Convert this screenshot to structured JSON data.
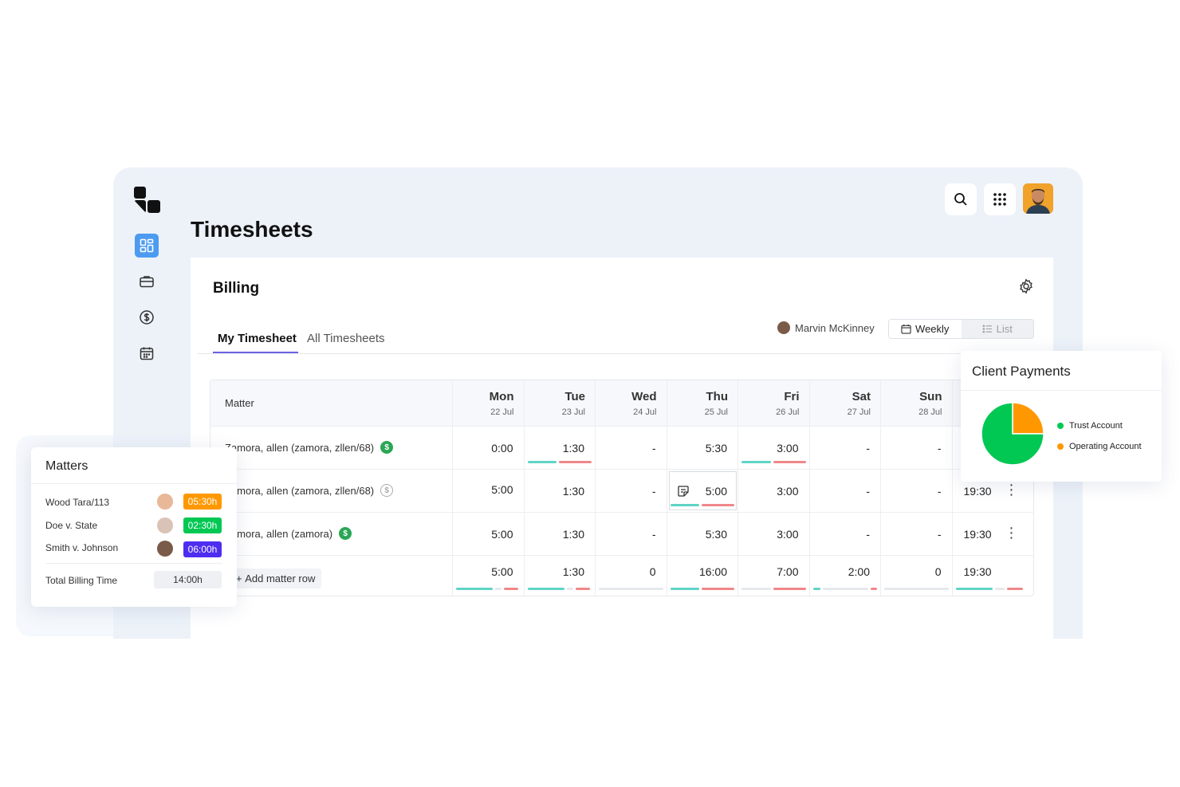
{
  "app": {
    "title": "Timesheets"
  },
  "colors": {
    "accent": "#4d9bf1",
    "tab_underline": "#6b63e4",
    "bar_teal": "#5fd4c5",
    "bar_red": "#f0878a",
    "bar_grey": "#e6e8ec",
    "green": "#00c853",
    "orange": "#ff9800",
    "purple": "#4e2df0"
  },
  "sidebar": {
    "icons": [
      "dashboard-icon",
      "briefcase-icon",
      "dollar-circle-icon",
      "calendar-icon"
    ]
  },
  "billing": {
    "title": "Billing",
    "tabs": [
      {
        "label": "My Timesheet"
      },
      {
        "label": "All Timesheets"
      }
    ],
    "user": "Marvin McKinney",
    "view_toggle": {
      "weekly": "Weekly",
      "list": "List"
    }
  },
  "table": {
    "matter_header": "Matter",
    "days": [
      {
        "name": "Mon",
        "date": "22 Jul"
      },
      {
        "name": "Tue",
        "date": "23 Jul"
      },
      {
        "name": "Wed",
        "date": "24 Jul"
      },
      {
        "name": "Thu",
        "date": "25 Jul"
      },
      {
        "name": "Fri",
        "date": "26 Jul"
      },
      {
        "name": "Sat",
        "date": "27 Jul"
      },
      {
        "name": "Sun",
        "date": "28 Jul"
      }
    ],
    "rows": [
      {
        "matter": "Zamora, allen (zamora, zllen/68)",
        "values": [
          "0:00",
          "1:30",
          "-",
          "5:30",
          "3:00",
          "-",
          "-"
        ],
        "total": ""
      },
      {
        "matter": "Zamora, allen (zamora, zllen/68)",
        "values": [
          "5:00",
          "1:30",
          "-",
          "5:00",
          "3:00",
          "-",
          "-"
        ],
        "total": "19:30"
      },
      {
        "matter": "Zamora, allen (zamora)",
        "values": [
          "5:00",
          "1:30",
          "-",
          "5:30",
          "3:00",
          "-",
          "-"
        ],
        "total": "19:30"
      }
    ],
    "add_row_label": "Add matter row",
    "totals": [
      "5:00",
      "1:30",
      "0",
      "16:00",
      "7:00",
      "2:00",
      "0"
    ],
    "grand_total": "19:30"
  },
  "matters_panel": {
    "title": "Matters",
    "items": [
      {
        "name": "Wood Tara/113",
        "hours": "05:30h",
        "color": "#ff9800"
      },
      {
        "name": "Doe v. State",
        "hours": "02:30h",
        "color": "#00c853"
      },
      {
        "name": "Smith v. Johnson",
        "hours": "06:00h",
        "color": "#4e2df0"
      }
    ],
    "total_label": "Total Billing Time",
    "total_value": "14:00h"
  },
  "chart_data": {
    "type": "pie",
    "title": "Client Payments",
    "categories": [
      "Trust Account",
      "Operating Account"
    ],
    "values": [
      75,
      25
    ],
    "colors": [
      "#00c853",
      "#ff9800"
    ],
    "legend": "right"
  }
}
